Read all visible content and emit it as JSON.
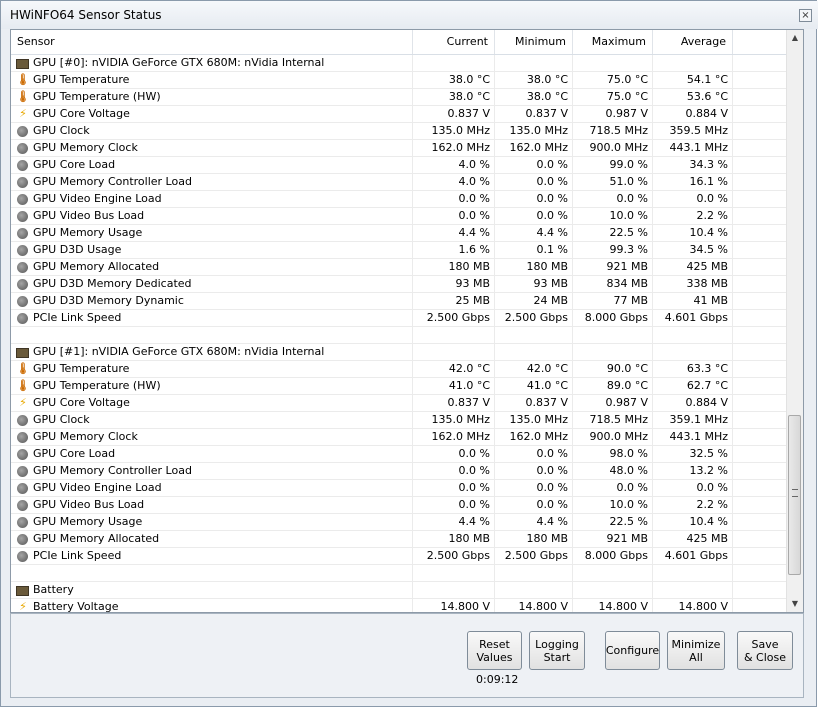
{
  "window": {
    "title": "HWiNFO64 Sensor Status",
    "close_glyph": "×"
  },
  "columns": {
    "sensor": "Sensor",
    "current": "Current",
    "minimum": "Minimum",
    "maximum": "Maximum",
    "average": "Average"
  },
  "rows": [
    {
      "icon": "chip",
      "label": "GPU [#0]: nVIDIA GeForce GTX 680M: nVidia Internal",
      "current": "",
      "minimum": "",
      "maximum": "",
      "average": ""
    },
    {
      "icon": "temp",
      "label": "GPU Temperature",
      "current": "38.0 °C",
      "minimum": "38.0 °C",
      "maximum": "75.0 °C",
      "average": "54.1 °C"
    },
    {
      "icon": "temp",
      "label": "GPU Temperature (HW)",
      "current": "38.0 °C",
      "minimum": "38.0 °C",
      "maximum": "75.0 °C",
      "average": "53.6 °C"
    },
    {
      "icon": "volt",
      "label": "GPU Core Voltage",
      "current": "0.837 V",
      "minimum": "0.837 V",
      "maximum": "0.987 V",
      "average": "0.884 V"
    },
    {
      "icon": "clock",
      "label": "GPU Clock",
      "current": "135.0 MHz",
      "minimum": "135.0 MHz",
      "maximum": "718.5 MHz",
      "average": "359.5 MHz"
    },
    {
      "icon": "clock",
      "label": "GPU Memory Clock",
      "current": "162.0 MHz",
      "minimum": "162.0 MHz",
      "maximum": "900.0 MHz",
      "average": "443.1 MHz"
    },
    {
      "icon": "clock",
      "label": "GPU Core Load",
      "current": "4.0 %",
      "minimum": "0.0 %",
      "maximum": "99.0 %",
      "average": "34.3 %"
    },
    {
      "icon": "clock",
      "label": "GPU Memory Controller Load",
      "current": "4.0 %",
      "minimum": "0.0 %",
      "maximum": "51.0 %",
      "average": "16.1 %"
    },
    {
      "icon": "clock",
      "label": "GPU Video Engine Load",
      "current": "0.0 %",
      "minimum": "0.0 %",
      "maximum": "0.0 %",
      "average": "0.0 %"
    },
    {
      "icon": "clock",
      "label": "GPU Video Bus Load",
      "current": "0.0 %",
      "minimum": "0.0 %",
      "maximum": "10.0 %",
      "average": "2.2 %"
    },
    {
      "icon": "clock",
      "label": "GPU Memory Usage",
      "current": "4.4 %",
      "minimum": "4.4 %",
      "maximum": "22.5 %",
      "average": "10.4 %"
    },
    {
      "icon": "clock",
      "label": "GPU D3D Usage",
      "current": "1.6 %",
      "minimum": "0.1 %",
      "maximum": "99.3 %",
      "average": "34.5 %"
    },
    {
      "icon": "clock",
      "label": "GPU Memory Allocated",
      "current": "180 MB",
      "minimum": "180 MB",
      "maximum": "921 MB",
      "average": "425 MB"
    },
    {
      "icon": "clock",
      "label": "GPU D3D Memory Dedicated",
      "current": "93 MB",
      "minimum": "93 MB",
      "maximum": "834 MB",
      "average": "338 MB"
    },
    {
      "icon": "clock",
      "label": "GPU D3D Memory Dynamic",
      "current": "25 MB",
      "minimum": "24 MB",
      "maximum": "77 MB",
      "average": "41 MB"
    },
    {
      "icon": "clock",
      "label": "PCIe Link Speed",
      "current": "2.500 Gbps",
      "minimum": "2.500 Gbps",
      "maximum": "8.000 Gbps",
      "average": "4.601 Gbps"
    },
    {
      "icon": "",
      "label": "",
      "current": "",
      "minimum": "",
      "maximum": "",
      "average": ""
    },
    {
      "icon": "chip",
      "label": "GPU [#1]: nVIDIA GeForce GTX 680M: nVidia Internal",
      "current": "",
      "minimum": "",
      "maximum": "",
      "average": ""
    },
    {
      "icon": "temp",
      "label": "GPU Temperature",
      "current": "42.0 °C",
      "minimum": "42.0 °C",
      "maximum": "90.0 °C",
      "average": "63.3 °C"
    },
    {
      "icon": "temp",
      "label": "GPU Temperature (HW)",
      "current": "41.0 °C",
      "minimum": "41.0 °C",
      "maximum": "89.0 °C",
      "average": "62.7 °C"
    },
    {
      "icon": "volt",
      "label": "GPU Core Voltage",
      "current": "0.837 V",
      "minimum": "0.837 V",
      "maximum": "0.987 V",
      "average": "0.884 V"
    },
    {
      "icon": "clock",
      "label": "GPU Clock",
      "current": "135.0 MHz",
      "minimum": "135.0 MHz",
      "maximum": "718.5 MHz",
      "average": "359.1 MHz"
    },
    {
      "icon": "clock",
      "label": "GPU Memory Clock",
      "current": "162.0 MHz",
      "minimum": "162.0 MHz",
      "maximum": "900.0 MHz",
      "average": "443.1 MHz"
    },
    {
      "icon": "clock",
      "label": "GPU Core Load",
      "current": "0.0 %",
      "minimum": "0.0 %",
      "maximum": "98.0 %",
      "average": "32.5 %"
    },
    {
      "icon": "clock",
      "label": "GPU Memory Controller Load",
      "current": "0.0 %",
      "minimum": "0.0 %",
      "maximum": "48.0 %",
      "average": "13.2 %"
    },
    {
      "icon": "clock",
      "label": "GPU Video Engine Load",
      "current": "0.0 %",
      "minimum": "0.0 %",
      "maximum": "0.0 %",
      "average": "0.0 %"
    },
    {
      "icon": "clock",
      "label": "GPU Video Bus Load",
      "current": "0.0 %",
      "minimum": "0.0 %",
      "maximum": "10.0 %",
      "average": "2.2 %"
    },
    {
      "icon": "clock",
      "label": "GPU Memory Usage",
      "current": "4.4 %",
      "minimum": "4.4 %",
      "maximum": "22.5 %",
      "average": "10.4 %"
    },
    {
      "icon": "clock",
      "label": "GPU Memory Allocated",
      "current": "180 MB",
      "minimum": "180 MB",
      "maximum": "921 MB",
      "average": "425 MB"
    },
    {
      "icon": "clock",
      "label": "PCIe Link Speed",
      "current": "2.500 Gbps",
      "minimum": "2.500 Gbps",
      "maximum": "8.000 Gbps",
      "average": "4.601 Gbps"
    },
    {
      "icon": "",
      "label": "",
      "current": "",
      "minimum": "",
      "maximum": "",
      "average": ""
    },
    {
      "icon": "chip",
      "label": "Battery",
      "current": "",
      "minimum": "",
      "maximum": "",
      "average": ""
    },
    {
      "icon": "volt",
      "label": "Battery Voltage",
      "current": "14.800 V",
      "minimum": "14.800 V",
      "maximum": "14.800 V",
      "average": "14.800 V"
    }
  ],
  "buttons": {
    "reset": [
      "Reset",
      "Values"
    ],
    "logging": [
      "Logging",
      "Start"
    ],
    "configure": [
      "Configure"
    ],
    "minimize": [
      "Minimize",
      "All"
    ],
    "save": [
      "Save",
      "& Close"
    ]
  },
  "timer": "0:09:12",
  "scroll_glyphs": {
    "up": "▲",
    "down": "▼"
  }
}
